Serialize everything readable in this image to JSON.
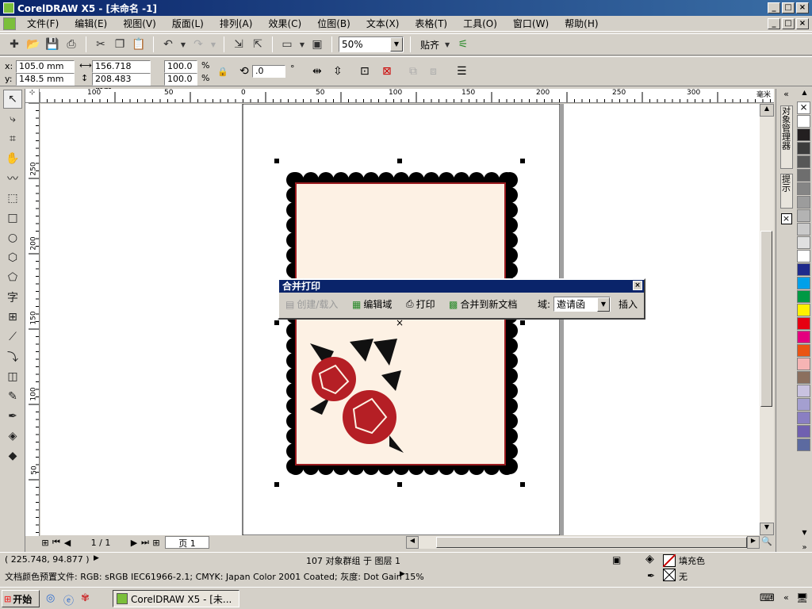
{
  "window": {
    "title": "CorelDRAW X5 - [未命名 -1]",
    "min": "_",
    "max": "□",
    "close": "×"
  },
  "menu": [
    "文件(F)",
    "编辑(E)",
    "视图(V)",
    "版面(L)",
    "排列(A)",
    "效果(C)",
    "位图(B)",
    "文本(X)",
    "表格(T)",
    "工具(O)",
    "窗口(W)",
    "帮助(H)"
  ],
  "standard_toolbar": {
    "zoom_value": "50%",
    "snap_label": "贴齐"
  },
  "property_bar": {
    "x_label": "x:",
    "x_value": "105.0 mm",
    "y_label": "y:",
    "y_value": "148.5 mm",
    "width_value": "156.718 mm",
    "height_value": "208.483 mm",
    "scale_x": "100.0",
    "scale_y": "100.0",
    "percent": "%",
    "rotation": ".0",
    "degree": "°"
  },
  "rulers": {
    "h_ticks": [
      "100",
      "50",
      "0",
      "50",
      "100",
      "150",
      "200",
      "250",
      "300"
    ],
    "v_ticks": [
      "250",
      "200",
      "150",
      "100",
      "50"
    ],
    "units": "毫米"
  },
  "merge_toolbar": {
    "title": "合并打印",
    "create_load": "创建/载入",
    "edit_fields": "编辑域",
    "print": "打印",
    "merge_new": "合并到新文档",
    "field_label": "域:",
    "field_value": "邀请函",
    "insert": "插入"
  },
  "page_nav": {
    "page_count": "1 / 1",
    "page_tab": "页 1"
  },
  "docker": {
    "tab1": "对象管理器",
    "tab2": "提示"
  },
  "status": {
    "coords": "( 225.748, 94.877 )",
    "selection": "107 对象群组 于 图层 1",
    "fill_label": "填充色",
    "outline_label": "无",
    "color_profile": "文档颜色预置文件: RGB: sRGB IEC61966-2.1; CMYK: Japan Color 2001 Coated; 灰度: Dot Gain 15%"
  },
  "taskbar": {
    "start": "开始",
    "task": "CorelDRAW X5 - [未..."
  },
  "palette": [
    "#ffffff",
    "#231f20",
    "#3c3c3c",
    "#575757",
    "#6e6e6e",
    "#858585",
    "#9c9c9c",
    "#b3b3b3",
    "#cacaca",
    "#e0e0e0",
    "#ffffff",
    "#1f2a8c",
    "#00a0e9",
    "#009944",
    "#fff100",
    "#e60012",
    "#e4007f",
    "#ea5413",
    "#f6b4b4",
    "#8b6f5e",
    "#c9c2e0",
    "#a49fd0",
    "#8a7fc2",
    "#7060b0",
    "#5c6aa0"
  ]
}
